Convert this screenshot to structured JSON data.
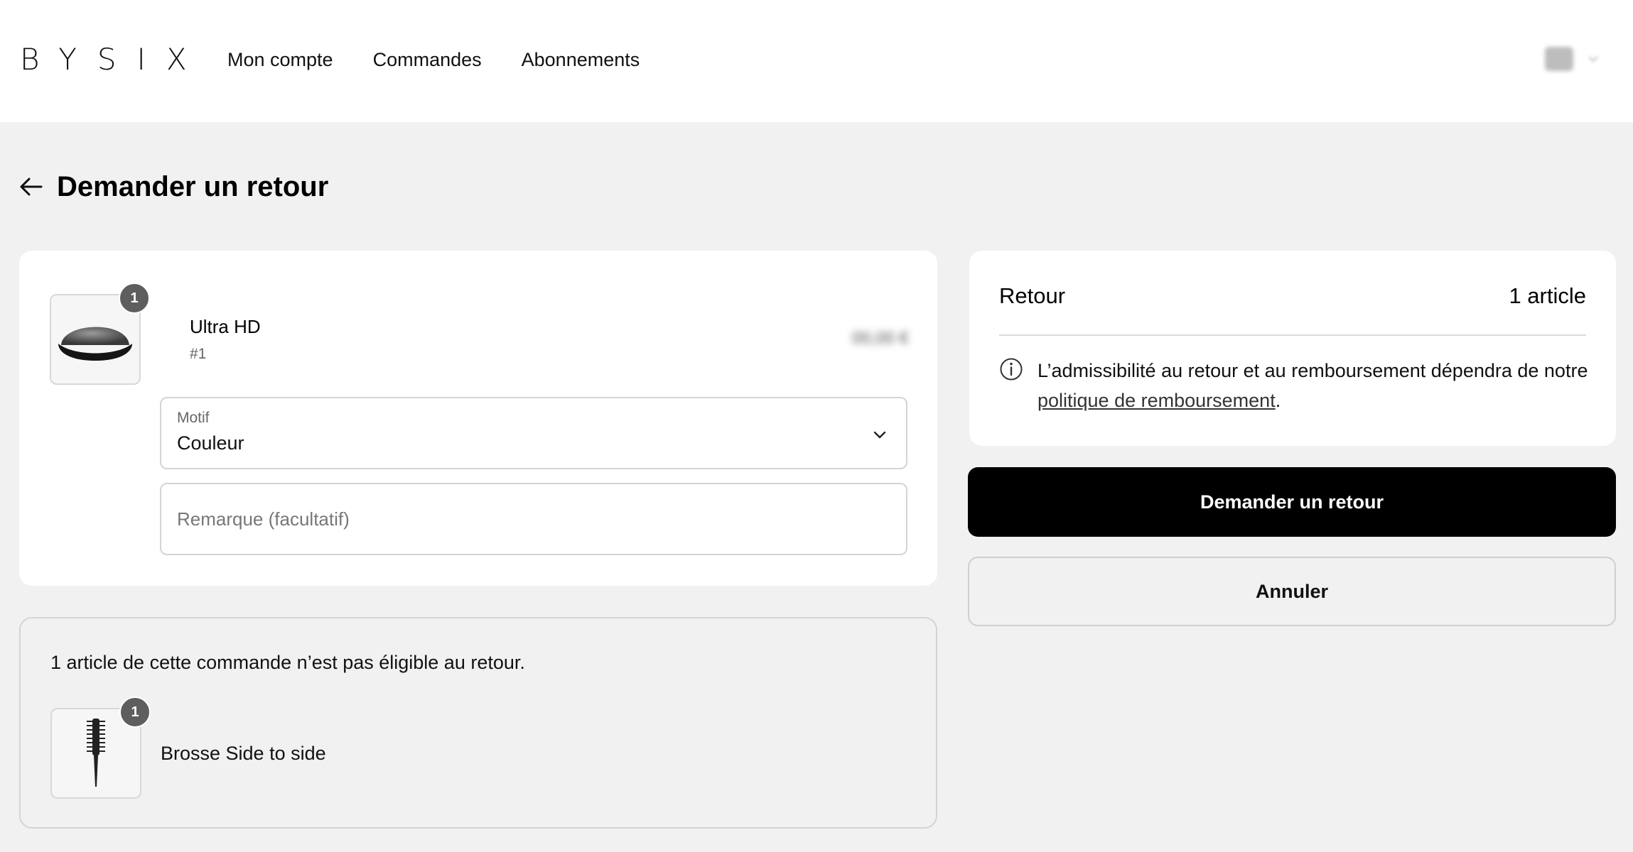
{
  "brand": {
    "logo_text": "BYSIX"
  },
  "nav": {
    "items": [
      {
        "label": "Mon compte"
      },
      {
        "label": "Commandes"
      },
      {
        "label": "Abonnements"
      }
    ]
  },
  "page": {
    "title": "Demander un retour"
  },
  "return_item": {
    "name": "Ultra HD",
    "sku": "#1",
    "quantity": "1",
    "price": "00,00 €",
    "reason": {
      "label": "Motif",
      "value": "Couleur"
    },
    "remark": {
      "placeholder": "Remarque (facultatif)",
      "value": ""
    }
  },
  "summary": {
    "label": "Retour",
    "count": "1 article",
    "info_text": "L’admissibilité au retour et au remboursement dépendra de notre",
    "policy_link": "politique de remboursement",
    "info_suffix": "."
  },
  "actions": {
    "submit_label": "Demander un retour",
    "cancel_label": "Annuler"
  },
  "ineligible": {
    "message": "1 article de cette commande n’est pas éligible au retour.",
    "item": {
      "name": "Brosse Side to side",
      "quantity": "1"
    }
  }
}
